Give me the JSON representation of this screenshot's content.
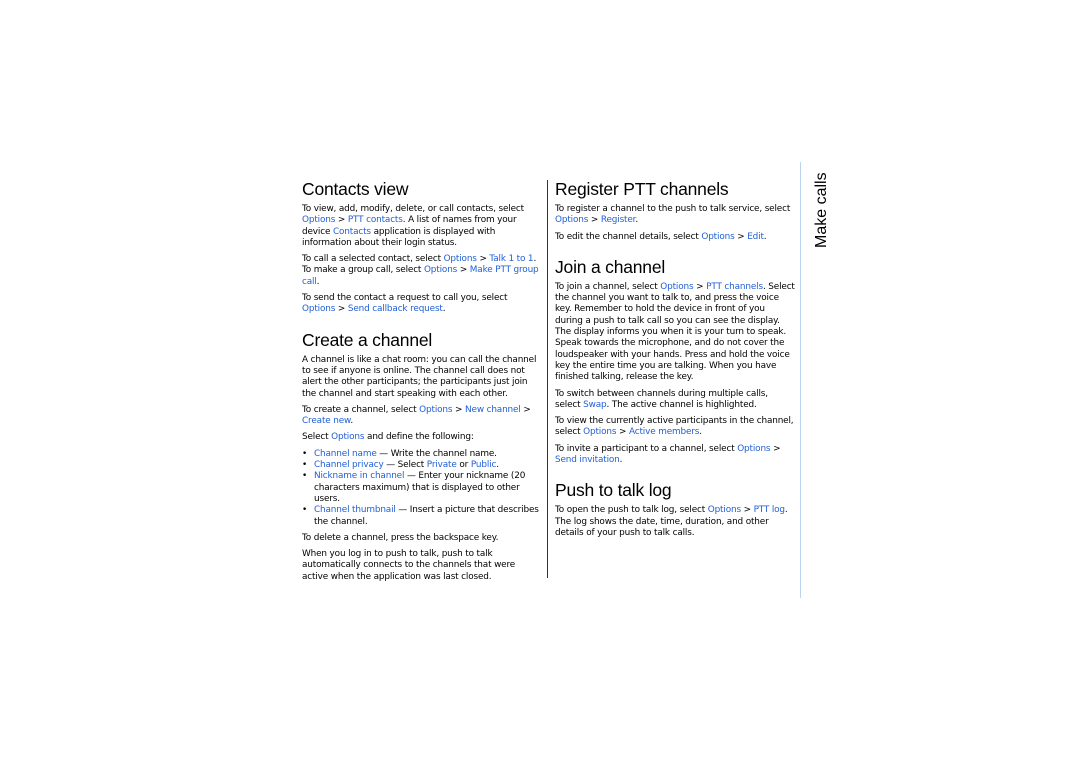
{
  "side_label": "Make calls",
  "left_column": {
    "contacts_view": {
      "title": "Contacts view",
      "p1": {
        "t1": "To view, add, modify, delete, or call contacts, select ",
        "l1": "Options",
        "sep1": " > ",
        "l2": "PTT contacts",
        "t2": ". A list of names from your device ",
        "l3": "Contacts",
        "t3": " application is displayed with information about their login status."
      },
      "p2": {
        "t1": "To call a selected contact, select ",
        "l1": "Options",
        "sep1": " > ",
        "l2": "Talk 1 to 1",
        "t2": ". To make a group call, select ",
        "l3": "Options",
        "sep2": " > ",
        "l4": "Make PTT group call",
        "t3": "."
      },
      "p3": {
        "t1": "To send the contact a request to call you, select ",
        "l1": "Options",
        "sep1": " > ",
        "l2": "Send callback request",
        "t2": "."
      }
    },
    "create_channel": {
      "title": "Create a channel",
      "p1": "A channel is like a chat room: you can call the channel to see if anyone is online. The channel call does not alert the other participants; the participants just join the channel and start speaking with each other.",
      "p2": {
        "t1": "To create a channel, select ",
        "l1": "Options",
        "sep1": " > ",
        "l2": "New channel",
        "sep2": " > ",
        "l3": "Create new",
        "t2": "."
      },
      "p3": {
        "t1": "Select ",
        "l1": "Options",
        "t2": " and define the following:"
      },
      "bullets": [
        {
          "bullet": "•",
          "term": "Channel name",
          "desc": "  — Write the channel name."
        },
        {
          "bullet": "•",
          "term": "Channel privacy",
          "desc1": "  — Select ",
          "opt1": "Private",
          "or": " or ",
          "opt2": "Public",
          "end": "."
        },
        {
          "bullet": "•",
          "term": "Nickname in channel",
          "desc": "  — Enter your nickname (20 characters maximum) that is displayed to other users."
        },
        {
          "bullet": "•",
          "term": "Channel thumbnail",
          "desc": "  — Insert a picture that describes the channel."
        }
      ],
      "p4": "To delete a channel, press the backspace key.",
      "p5": "When you log in to push to talk, push to talk automatically connects to the channels that were active when the application was last closed."
    }
  },
  "mid_column": {
    "register": {
      "title": "Register PTT channels",
      "p1": {
        "t1": "To register a channel to the push to talk service, select ",
        "l1": "Options",
        "sep1": " > ",
        "l2": "Register",
        "t2": "."
      },
      "p2": {
        "t1": "To edit the channel details, select ",
        "l1": "Options",
        "sep1": " > ",
        "l2": "Edit",
        "t2": "."
      }
    },
    "join": {
      "title": "Join a channel",
      "p1": {
        "t1": "To join a channel, select ",
        "l1": "Options",
        "sep1": " > ",
        "l2": "PTT channels",
        "t2": ". Select the channel you want to talk to, and press the voice key. Remember to hold the device in front of you during a push to talk call so you can see the display. The display informs you when it is your turn to speak. Speak towards the microphone, and do not cover the loudspeaker with your hands. Press and hold the voice key the entire time you are talking. When you have finished talking, release the key."
      },
      "p2": {
        "t1": "To switch between channels during multiple calls, select ",
        "l1": "Swap",
        "t2": ". The active channel is highlighted."
      },
      "p3": {
        "t1": "To view the currently active participants in the channel, select ",
        "l1": "Options",
        "sep1": " > ",
        "l2": "Active members",
        "t2": "."
      },
      "p4": {
        "t1": "To invite a participant to a channel, select ",
        "l1": "Options",
        "sep1": " > ",
        "l2": "Send invitation",
        "t2": "."
      }
    },
    "log": {
      "title": "Push to talk log",
      "p1": {
        "t1": "To open the push to talk log, select ",
        "l1": "Options",
        "sep1": " > ",
        "l2": "PTT log",
        "t2": ". The log shows the date, time, duration, and other details of your push to talk calls."
      }
    }
  }
}
